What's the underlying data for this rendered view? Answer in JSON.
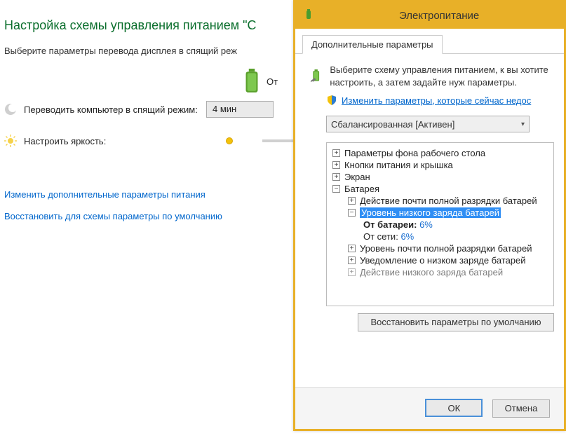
{
  "left_pane": {
    "title": "Настройка схемы управления питанием \"С",
    "subtitle": "Выберите параметры перевода дисплея в спящий реж",
    "battery_label_prefix": "От",
    "sleep_label": "Переводить компьютер в спящий режим:",
    "sleep_value": "4 мин",
    "brightness_label": "Настроить яркость:",
    "link_advanced": "Изменить дополнительные параметры питания",
    "link_restore": "Восстановить для схемы параметры по умолчанию"
  },
  "dialog": {
    "title": "Электропитание",
    "tab_label": "Дополнительные параметры",
    "intro_text": "Выберите схему управления питанием, к вы хотите настроить, а затем задайте нуж параметры.",
    "protected_link": "Изменить параметры, которые сейчас недос",
    "plan_select_value": "Сбалансированная [Активен]",
    "tree": {
      "desktop_bg": "Параметры фона рабочего стола",
      "power_buttons": "Кнопки питания и крышка",
      "screen": "Экран",
      "battery": "Батарея",
      "critical_action": "Действие почти полной разрядки батарей",
      "low_level": "Уровень низкого заряда батарей",
      "on_battery_label": "От батареи:",
      "on_battery_value": "6%",
      "on_ac_label": "От сети:",
      "on_ac_value": "6%",
      "critical_level": "Уровень почти полной разрядки батарей",
      "low_notification": "Уведомление о низком заряде батарей",
      "low_action_cut": "Действие низкого заряда батарей"
    },
    "restore_defaults": "Восстановить параметры по умолчанию",
    "ok": "ОК",
    "cancel": "Отмена"
  }
}
